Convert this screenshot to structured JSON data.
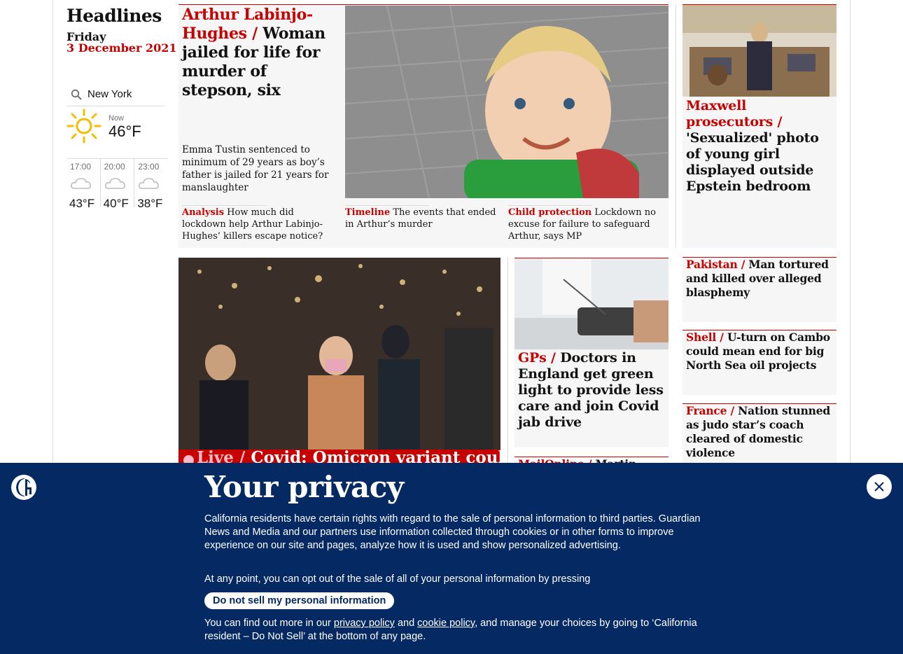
{
  "sidebar": {
    "section_title": "Headlines",
    "day": "Friday",
    "date": "3 December 2021"
  },
  "weather": {
    "location": "New York",
    "now_label": "Now",
    "now_temp": "46°F",
    "now_icon": "sun-icon",
    "forecast": [
      {
        "time": "17:00",
        "temp": "43°F",
        "icon": "cloud-moon-icon"
      },
      {
        "time": "20:00",
        "temp": "40°F",
        "icon": "cloud-moon-icon"
      },
      {
        "time": "23:00",
        "temp": "38°F",
        "icon": "cloud-moon-icon"
      }
    ]
  },
  "feature": {
    "kicker": "Arthur Labinjo-Hughes /",
    "headline": "Woman jailed for life for murder of stepson, six",
    "standfirst": "Emma Tustin sentenced to minimum of 29 years as boy’s father is jailed for 21 years for manslaughter",
    "sublinks": [
      {
        "kicker": "Analysis",
        "text": "How much did lockdown help Arthur Labinjo-Hughes’ killers escape notice?"
      },
      {
        "kicker": "Timeline",
        "text": "The events that ended in Arthur’s murder"
      },
      {
        "kicker": "Child protection",
        "text": "Lockdown no excuse for failure to safeguard Arthur, says MP"
      }
    ]
  },
  "maxwell": {
    "kicker": "Maxwell prosecutors /",
    "headline": "'Sexualized' photo of young girl displayed outside Epstein bedroom"
  },
  "live": {
    "kicker": "Live /",
    "headline": "Covid: Omicron variant could"
  },
  "gps": {
    "kicker": "GPs /",
    "headline": "Doctors in England get green light to provide less care and join Covid jab drive"
  },
  "mail": {
    "kicker": "MailOnline /",
    "headline": "Martin"
  },
  "right_stories": [
    {
      "kicker": "Pakistan /",
      "headline": "Man tortured and killed over alleged blasphemy"
    },
    {
      "kicker": "Shell /",
      "headline": "U-turn on Cambo could mean end for big North Sea oil projects"
    },
    {
      "kicker": "France /",
      "headline": "Nation stunned as judo star’s coach cleared of domestic violence"
    }
  ],
  "privacy": {
    "title": "Your privacy",
    "para1": "California residents have certain rights with regard to the sale of personal information to third parties. Guardian News and Media and our partners use information collected through cookies or in other forms to improve experience on our site and pages, analyze how it is used and show personalized advertising.",
    "para2": "At any point, you can opt out of the sale of all of your personal information by pressing",
    "button": "Do not sell my personal information",
    "para3_a": "You can find out more in our",
    "privacy_link": "privacy policy",
    "and": "and",
    "cookie_link": "cookie policy",
    "para3_b": ", and manage your choices by going to ‘California resident – Do Not Sell’ at the bottom of any page."
  },
  "colors": {
    "brand_navy": "#052962",
    "news_red": "#c70000",
    "panel_grey": "#f6f6f6"
  }
}
